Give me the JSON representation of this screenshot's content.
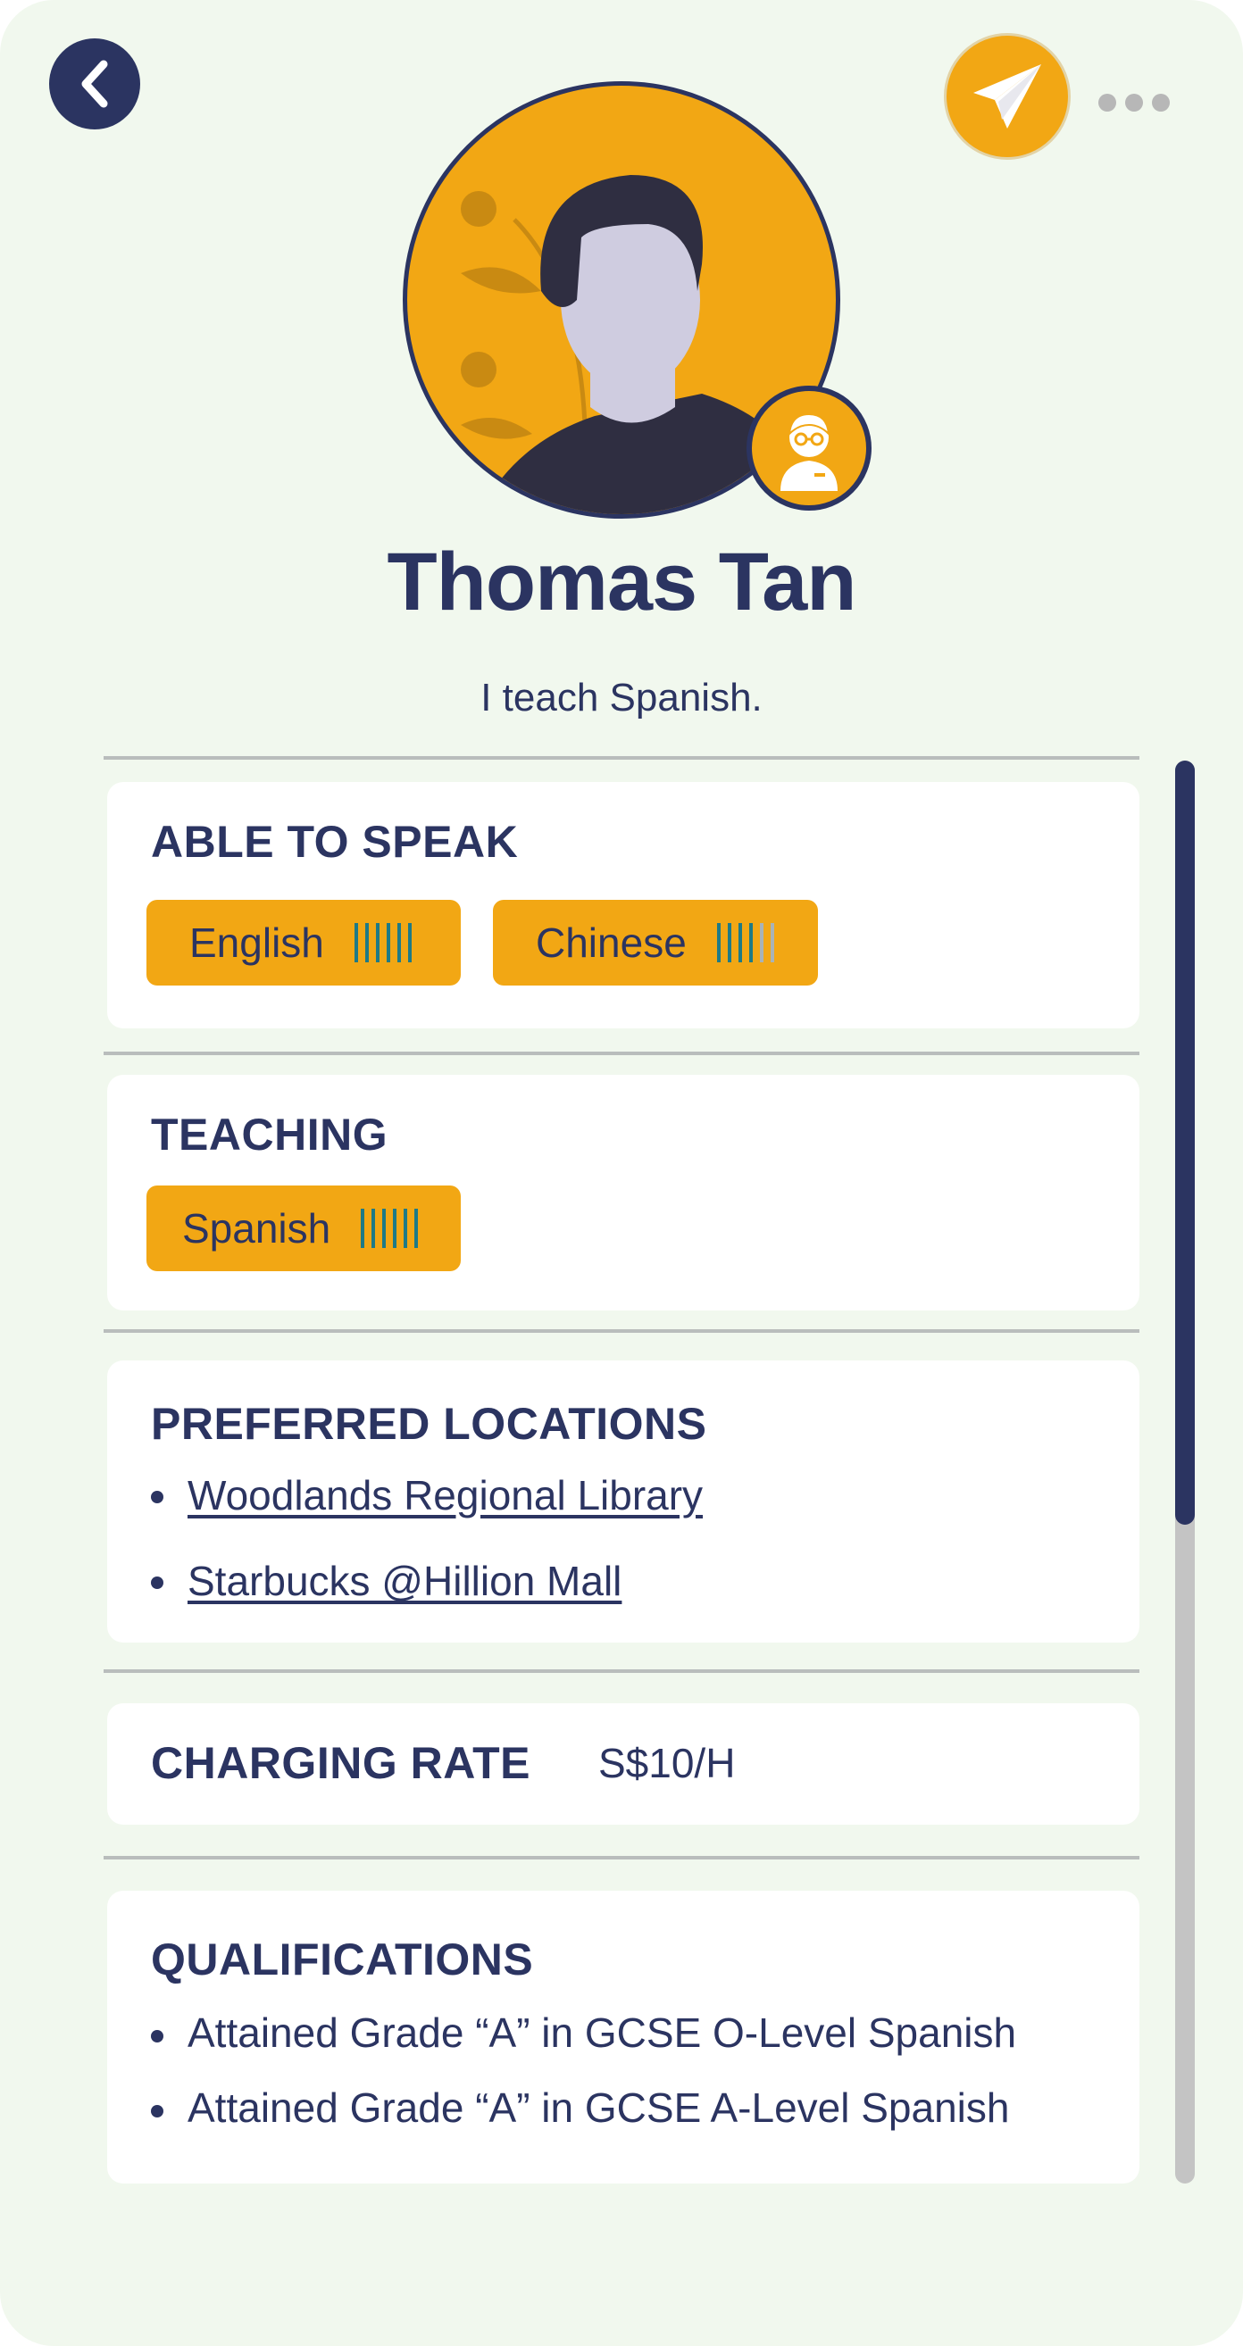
{
  "profile": {
    "name": "Thomas Tan",
    "bio": "I teach Spanish."
  },
  "colors": {
    "navy": "#2b3461",
    "accent": "#f2a714",
    "background": "#f1f8ee",
    "level_on": "#1e7a86",
    "level_off": "#a9b3b8"
  },
  "icons": {
    "back": "chevron-left-icon",
    "send": "paper-plane-icon",
    "more": "more-dots-icon",
    "role": "tutor-badge-icon"
  },
  "sections": {
    "speak": {
      "title": "ABLE TO SPEAK",
      "languages": [
        {
          "label": "English",
          "level": 6,
          "max": 6
        },
        {
          "label": "Chinese",
          "level": 4,
          "max": 6
        }
      ]
    },
    "teaching": {
      "title": "TEACHING",
      "languages": [
        {
          "label": "Spanish",
          "level": 6,
          "max": 6
        }
      ]
    },
    "locations": {
      "title": "PREFERRED LOCATIONS",
      "items": [
        "Woodlands Regional Library",
        "Starbucks @Hillion Mall"
      ]
    },
    "rate": {
      "title": "CHARGING RATE",
      "value": "S$10/H"
    },
    "qualifications": {
      "title": "QUALIFICATIONS",
      "items": [
        "Attained Grade “A” in GCSE O-Level Spanish",
        "Attained Grade “A” in GCSE A-Level Spanish"
      ]
    }
  },
  "scroll_position": 0.0
}
